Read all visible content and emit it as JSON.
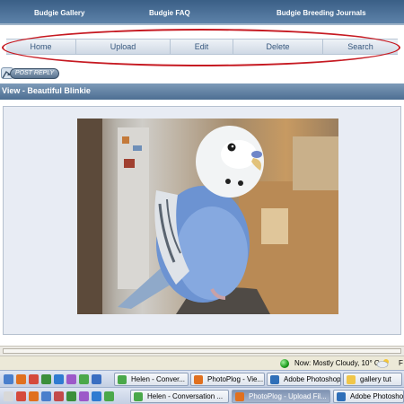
{
  "top_nav": {
    "links": [
      {
        "label": "Budgie Gallery"
      },
      {
        "label": "Budgie FAQ"
      },
      {
        "label": "Budgie Breeding Journals"
      }
    ]
  },
  "menu": {
    "items": [
      {
        "label": "Home"
      },
      {
        "label": "Upload"
      },
      {
        "label": "Edit"
      },
      {
        "label": "Delete"
      },
      {
        "label": "Search"
      }
    ]
  },
  "post_reply": {
    "label": "POST REPLY"
  },
  "view": {
    "title": "View - Beautiful Blinkie"
  },
  "status_bar": {
    "weather": "Now: Mostly Cloudy, 10° C",
    "trailing": "F"
  },
  "taskbar_top": {
    "tasks": [
      {
        "label": "Helen - Conver..."
      },
      {
        "label": "PhotoPlog - Vie..."
      },
      {
        "label": "Adobe Photoshop"
      },
      {
        "label": "gallery tut"
      }
    ]
  },
  "taskbar_bottom": {
    "tasks": [
      {
        "label": "Helen - Conversation ..."
      },
      {
        "label": "PhotoPlog - Upload Fil..."
      },
      {
        "label": "Adobe Photoshop"
      }
    ]
  },
  "colors": {
    "accent": "#4d6e92",
    "highlight_ellipse": "#c61a22",
    "menu_text": "#36577d"
  },
  "icons": [
    "post-reply-arrow-icon",
    "weather-status-icon",
    "cloud-icon",
    "firefox-icon",
    "msn-icon",
    "photoshop-icon",
    "folder-icon"
  ]
}
